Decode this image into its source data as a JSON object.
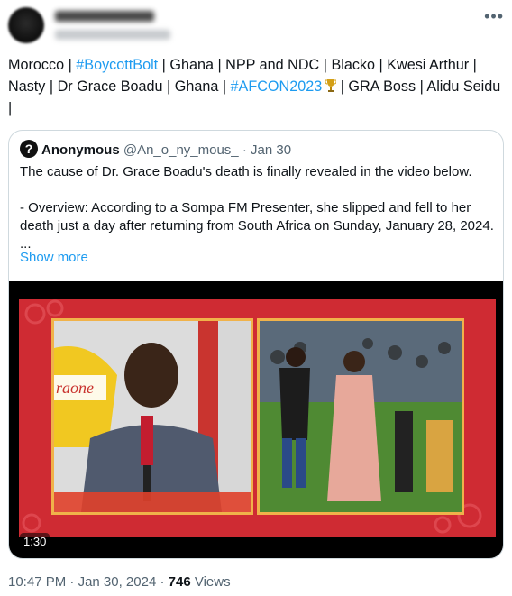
{
  "tweet": {
    "text_parts": [
      "Morocco | ",
      "#BoycottBolt",
      " | Ghana | NPP and NDC | Blacko | Kwesi Arthur | Nasty | Dr Grace Boadu | Ghana | ",
      "#AFCON2023",
      " | GRA Boss | Alidu Seidu |"
    ],
    "trophy_icon": "trophy-icon",
    "more_icon": "more-horizontal-icon"
  },
  "quote": {
    "name": "Anonymous",
    "handle": "@An_o_ny_mous_",
    "sep": " · ",
    "date": "Jan 30",
    "line1": "The cause of Dr. Grace Boadu's death is finally revealed in the video below.",
    "line2": "- Overview: According to a Sompa FM Presenter, she slipped and fell to her death just a day after returning from South Africa on Sunday, January 28, 2024.",
    "line3": "...",
    "show_more": "Show more"
  },
  "video": {
    "duration": "1:30"
  },
  "footer": {
    "time": "10:47 PM",
    "sep1": " · ",
    "date": "Jan 30, 2024",
    "sep2": " · ",
    "views_count": "746",
    "views_label": " Views"
  }
}
